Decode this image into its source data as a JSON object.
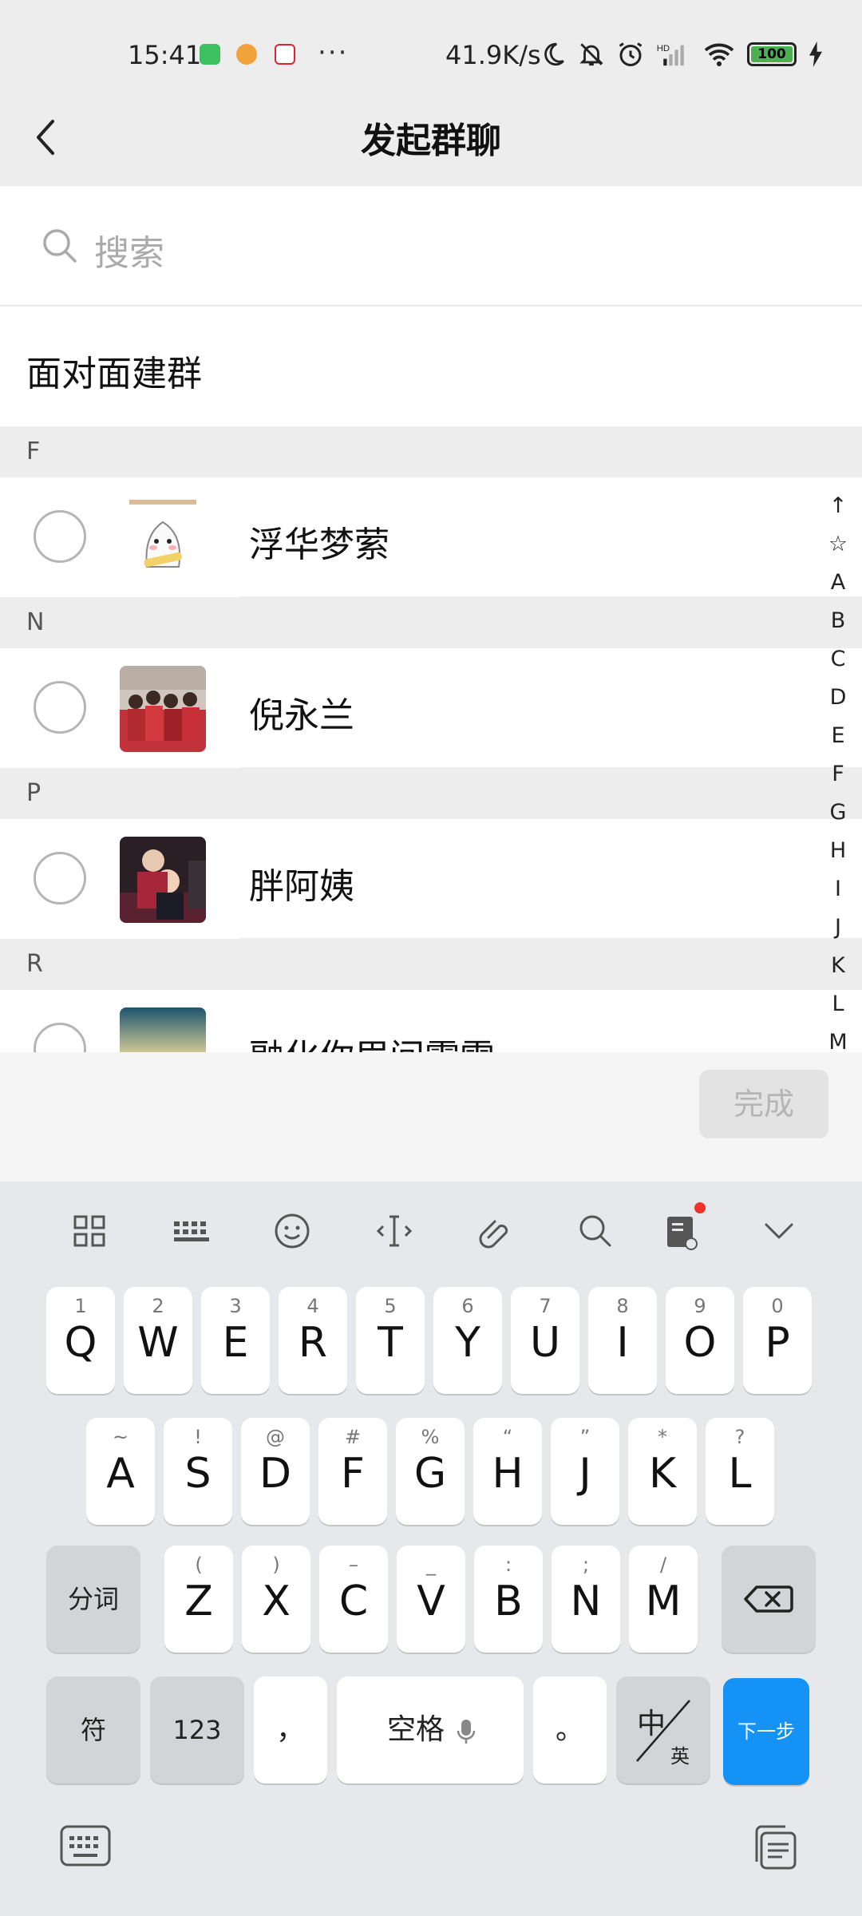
{
  "status_bar": {
    "time": "15:41",
    "dots": "···",
    "net_speed": "41.9K/s",
    "battery": "100",
    "icons": [
      "app-green-icon",
      "app-tiger-icon",
      "app-red-icon",
      "moon-icon",
      "mute-bell-icon",
      "alarm-icon",
      "hd-signal-icon",
      "wifi-icon",
      "battery-icon",
      "charging-icon"
    ]
  },
  "header": {
    "title": "发起群聊",
    "back_icon": "chevron-left-icon"
  },
  "search": {
    "placeholder": "搜索",
    "icon": "search-icon"
  },
  "face_to_face": {
    "label": "面对面建群"
  },
  "sections": [
    {
      "letter": "F",
      "contacts": [
        {
          "name": "浮华梦萦",
          "avatar": "ghost-sticker-avatar"
        }
      ]
    },
    {
      "letter": "N",
      "contacts": [
        {
          "name": "倪永兰",
          "avatar": "group-photo-avatar"
        }
      ]
    },
    {
      "letter": "P",
      "contacts": [
        {
          "name": "胖阿姨",
          "avatar": "kids-photo-avatar"
        }
      ]
    },
    {
      "letter": "R",
      "contacts": [
        {
          "name": "融化你眉间霜雪",
          "avatar": "sunset-avatar"
        }
      ]
    }
  ],
  "index_bar": [
    "↑",
    "☆",
    "A",
    "B",
    "C",
    "D",
    "E",
    "F",
    "G",
    "H",
    "I",
    "J",
    "K",
    "L",
    "M"
  ],
  "action": {
    "done_label": "完成"
  },
  "keyboard": {
    "toolbar": [
      "grid-icon",
      "keyboard-layout-icon",
      "emoji-icon",
      "cursor-icon",
      "clip-icon",
      "search-icon",
      "book-icon",
      "collapse-icon"
    ],
    "row1": [
      {
        "hint": "1",
        "key": "Q"
      },
      {
        "hint": "2",
        "key": "W"
      },
      {
        "hint": "3",
        "key": "E"
      },
      {
        "hint": "4",
        "key": "R"
      },
      {
        "hint": "5",
        "key": "T"
      },
      {
        "hint": "6",
        "key": "Y"
      },
      {
        "hint": "7",
        "key": "U"
      },
      {
        "hint": "8",
        "key": "I"
      },
      {
        "hint": "9",
        "key": "O"
      },
      {
        "hint": "0",
        "key": "P"
      }
    ],
    "row2": [
      {
        "hint": "~",
        "key": "A"
      },
      {
        "hint": "!",
        "key": "S"
      },
      {
        "hint": "@",
        "key": "D"
      },
      {
        "hint": "#",
        "key": "F"
      },
      {
        "hint": "%",
        "key": "G"
      },
      {
        "hint": "“",
        "key": "H"
      },
      {
        "hint": "”",
        "key": "J"
      },
      {
        "hint": "*",
        "key": "K"
      },
      {
        "hint": "?",
        "key": "L"
      }
    ],
    "row3": [
      {
        "hint": "(",
        "key": "Z"
      },
      {
        "hint": ")",
        "key": "X"
      },
      {
        "hint": "–",
        "key": "C"
      },
      {
        "hint": "_",
        "key": "V"
      },
      {
        "hint": ":",
        "key": "B"
      },
      {
        "hint": ";",
        "key": "N"
      },
      {
        "hint": "/",
        "key": "M"
      }
    ],
    "segment_label": "分词",
    "symbols_label": "符",
    "numbers_label": "123",
    "comma": "，",
    "space_label": "空格",
    "period": "。",
    "lang_top": "中",
    "lang_bottom": "英",
    "next_label": "下一步"
  }
}
